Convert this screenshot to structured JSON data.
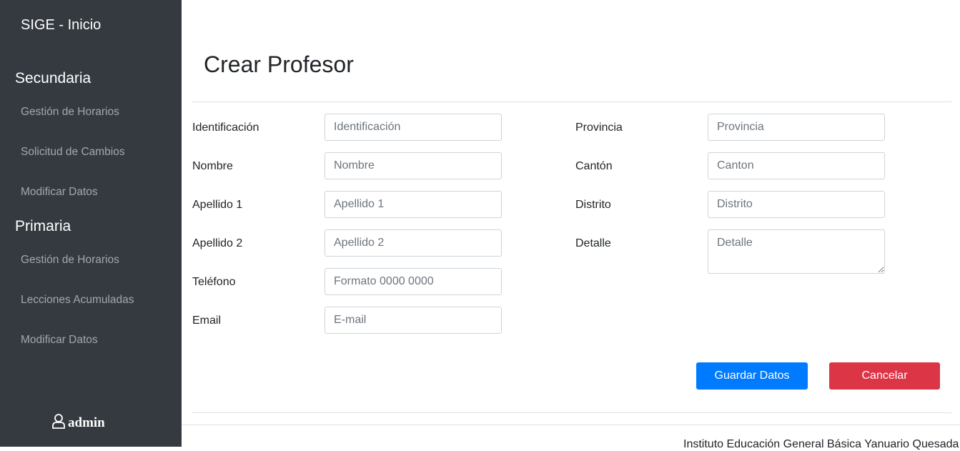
{
  "sidebar": {
    "brand": "SIGE - Inicio",
    "sections": [
      {
        "title": "Secundaria",
        "items": [
          "Gestión de Horarios",
          "Solicitud de Cambios",
          "Modificar Datos"
        ]
      },
      {
        "title": "Primaria",
        "items": [
          "Gestión de Horarios",
          "Lecciones Acumuladas",
          "Modificar Datos"
        ]
      }
    ],
    "user": {
      "icon": "user-icon",
      "name": "admin"
    }
  },
  "page": {
    "title": "Crear Profesor"
  },
  "form": {
    "left": [
      {
        "label": "Identificación",
        "placeholder": "Identificación"
      },
      {
        "label": "Nombre",
        "placeholder": "Nombre"
      },
      {
        "label": "Apellido 1",
        "placeholder": "Apellido 1"
      },
      {
        "label": "Apellido 2",
        "placeholder": "Apellido 2"
      },
      {
        "label": "Teléfono",
        "placeholder": "Formato 0000 0000"
      },
      {
        "label": "Email",
        "placeholder": "E-mail"
      }
    ],
    "right": [
      {
        "label": "Provincia",
        "placeholder": "Provincia"
      },
      {
        "label": "Cantón",
        "placeholder": "Canton"
      },
      {
        "label": "Distrito",
        "placeholder": "Distrito"
      },
      {
        "label": "Detalle",
        "placeholder": "Detalle"
      }
    ],
    "save_label": "Guardar Datos",
    "cancel_label": "Cancelar"
  },
  "footer": {
    "text": "Instituto Educación General Básica Yanuario Quesada"
  },
  "colors": {
    "sidebar_bg": "#343a40",
    "primary": "#007bff",
    "danger": "#dc3545"
  }
}
